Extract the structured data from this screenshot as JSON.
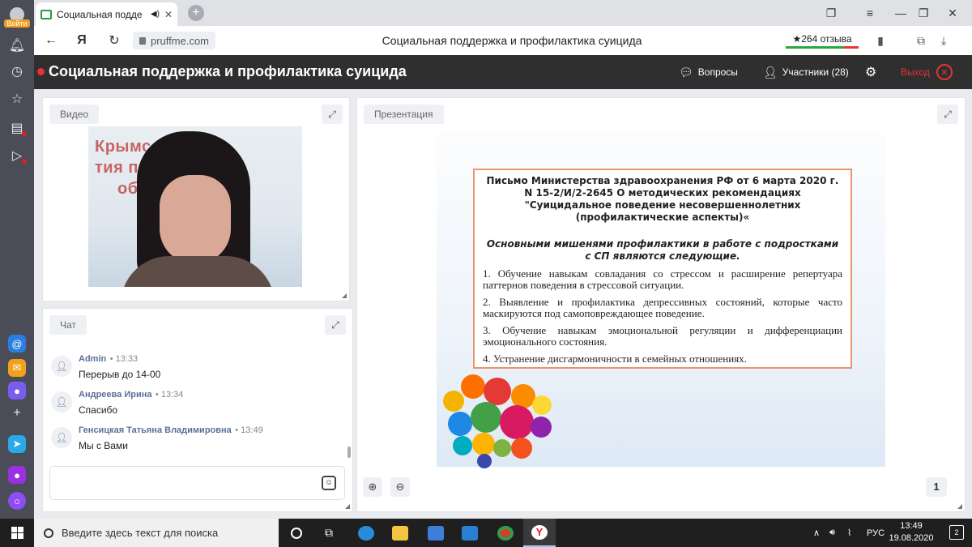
{
  "browser": {
    "sidebar_login_label": "Войти",
    "tab_title": "Социальная подде",
    "url": "pruffme.com",
    "page_title": "Социальная поддержка и профилактика суицида",
    "reviews": "★264 отзыва"
  },
  "app": {
    "title": "Социальная поддержка и профилактика суицида",
    "questions_label": "Вопросы",
    "participants_label": "Участники (28)",
    "exit_label": "Выход"
  },
  "video_panel": {
    "label": "Видео",
    "bg_text_1": "Крымс        тр",
    "bg_text_2": "тия пр      ального",
    "bg_text_3": "об"
  },
  "chat_panel": {
    "label": "Чат",
    "messages": [
      {
        "name": "Admin",
        "time": "• 13:33",
        "text": "Перерыв до 14-00"
      },
      {
        "name": "Андреева Ирина",
        "time": "• 13:34",
        "text": "Спасибо"
      },
      {
        "name": "Генсицкая Татьяна Владимировна",
        "time": "• 13:49",
        "text": "Мы с Вами"
      }
    ]
  },
  "presentation_panel": {
    "label": "Презентация",
    "page": "1",
    "slide": {
      "heading": "Письмо Министерства здравоохранения РФ от 6 марта 2020 г. N 15-2/И/2-2645 О методических рекомендациях \"Суицидальное поведение несовершеннолетних (профилактические аспекты)«",
      "subheading": "Основными мишенями профилактики в работе с подростками с СП являются следующие.",
      "items": [
        "1. Обучение навыкам совладания со стрессом и расширение репертуара паттернов поведения в стрессовой ситуации.",
        "2. Выявление и профилактика депрессивных состояний, которые часто маскируются под самоповреждающее поведение.",
        "3. Обучение навыкам эмоциональной регуляции и дифференциации эмоционального состояния.",
        "4. Устранение дисгармоничности в семейных отношениях."
      ]
    }
  },
  "taskbar": {
    "search_placeholder": "Введите здесь текст для поиска",
    "lang": "РУС",
    "time": "13:49",
    "date": "19.08.2020",
    "notifications": "2"
  },
  "colors": {
    "accent_red": "#e63234",
    "header_bg": "#2f2f2f",
    "name_blue": "#5a7097",
    "slide_border": "#e9966a"
  }
}
